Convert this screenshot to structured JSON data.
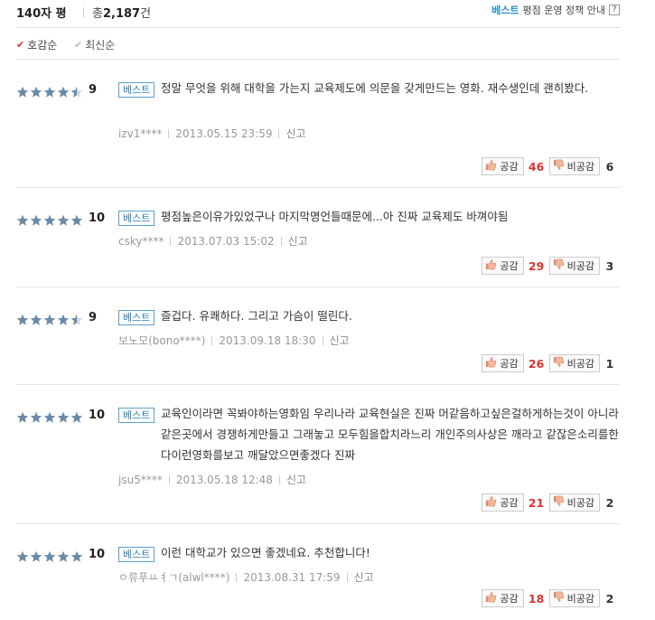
{
  "header": {
    "title": "140자 평",
    "count_prefix": "총",
    "count": "2,187",
    "count_suffix": "건",
    "policy_best": "베스트",
    "policy_text": "평점 운영 정책 안내",
    "policy_help": "?"
  },
  "sort": {
    "options": [
      {
        "label": "호감순",
        "active": true
      },
      {
        "label": "최신순",
        "active": false
      }
    ]
  },
  "labels": {
    "best_badge": "베스트",
    "like": "공감",
    "dislike": "비공감",
    "report": "신고"
  },
  "colors": {
    "star_fill": "#6b8aa6",
    "like_count": "#dd3333",
    "badge_border": "#5aa0c8"
  },
  "reviews": [
    {
      "stars": 4.5,
      "score": "9",
      "text": "정말 무엇을 위해 대학을 가는지 교육제도에 의문을 갖게만드는 영화. 재수생인데 괜히봤다.",
      "user": "izv1****",
      "date": "2013.05.15 23:59",
      "likes": "46",
      "dislikes": "6"
    },
    {
      "stars": 5,
      "score": "10",
      "text": "평점높은이유가있었구나 마지막명언들때문에...아 진짜 교육제도 바껴야됨",
      "user": "csky****",
      "date": "2013.07.03 15:02",
      "likes": "29",
      "dislikes": "3"
    },
    {
      "stars": 4.5,
      "score": "9",
      "text": "즐겁다. 유쾌하다. 그리고 가슴이 떨린다.",
      "user": "보노모(bono****)",
      "date": "2013.09.18 18:30",
      "likes": "26",
      "dislikes": "1"
    },
    {
      "stars": 5,
      "score": "10",
      "text": "교육인이라면 꼭봐야하는영화임 우리나라 교육현실은 진짜 머같음하고싶은걸하게하는것이 아니라 같은곳에서 경쟁하게만들고 그래놓고 모두힘을합치라느리 개인주의사상은 깨라고 같잖은소리를한다이런영화를보고 깨달았으면좋겠다 진짜",
      "user": "jsu5****",
      "date": "2013.05.18 12:48",
      "likes": "21",
      "dislikes": "2"
    },
    {
      "stars": 5,
      "score": "10",
      "text": "이런 대학교가 있으면 좋겠네요. 추천합니다!",
      "user": "ㅇ류푸ㅛㅕㄱ(alwl****)",
      "date": "2013.08.31 17:59",
      "likes": "18",
      "dislikes": "2"
    }
  ]
}
